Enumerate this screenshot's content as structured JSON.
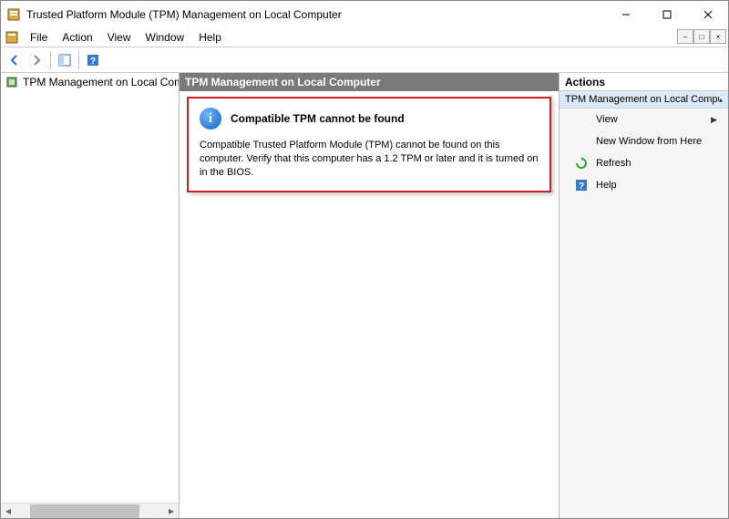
{
  "window": {
    "title": "Trusted Platform Module (TPM) Management on Local Computer"
  },
  "menu": {
    "file": "File",
    "action": "Action",
    "view": "View",
    "window": "Window",
    "help": "Help"
  },
  "tree": {
    "root": "TPM Management on Local Comp"
  },
  "content": {
    "header": "TPM Management on Local Computer",
    "info_title": "Compatible TPM cannot be found",
    "info_text": "Compatible Trusted Platform Module (TPM) cannot be found on this computer. Verify that this computer has a 1.2 TPM or later and it is turned on in the BIOS."
  },
  "actions": {
    "header": "Actions",
    "group": "TPM Management on Local Computer",
    "view": "View",
    "new_window": "New Window from Here",
    "refresh": "Refresh",
    "help": "Help"
  }
}
